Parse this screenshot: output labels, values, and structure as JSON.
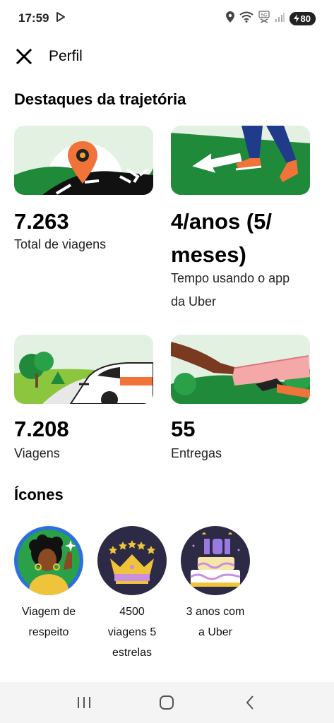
{
  "status_bar": {
    "time": "17:59",
    "battery": "80",
    "icons": [
      "play-icon",
      "location-icon",
      "wifi-icon",
      "5g-icon",
      "signal-icon",
      "battery-icon"
    ]
  },
  "header": {
    "title": "Perfil",
    "close_icon": "close-icon"
  },
  "highlights": {
    "title": "Destaques da trajetória",
    "stats": [
      {
        "value": "7.263",
        "label": "Total de viagens"
      },
      {
        "value": "4/anos (5/ meses)",
        "value_line1": "4/anos (5/",
        "value_line2": "meses)",
        "label": "Tempo usando o app da Uber",
        "label_line1": "Tempo usando o app",
        "label_line2": "da Uber"
      },
      {
        "value": "7.208",
        "label": "Viagens"
      },
      {
        "value": "55",
        "label": "Entregas"
      }
    ]
  },
  "icons_section": {
    "title": "Ícones",
    "badges": [
      {
        "label": "Viagem de respeito",
        "line1": "Viagem de",
        "line2": "respeito"
      },
      {
        "label": "4500 viagens 5 estrelas",
        "line1": "4500",
        "line2": "viagens 5",
        "line3": "estrelas"
      },
      {
        "label": "3 anos com a Uber",
        "line1": "3 anos com",
        "line2": "a Uber"
      }
    ]
  },
  "nav": {
    "recent": "recent-apps-icon",
    "home": "home-icon",
    "back": "back-icon"
  },
  "colors": {
    "green_dark": "#1f8a3a",
    "green_light": "#e3f1e3",
    "orange": "#f0733a",
    "navy": "#2c2a45"
  }
}
